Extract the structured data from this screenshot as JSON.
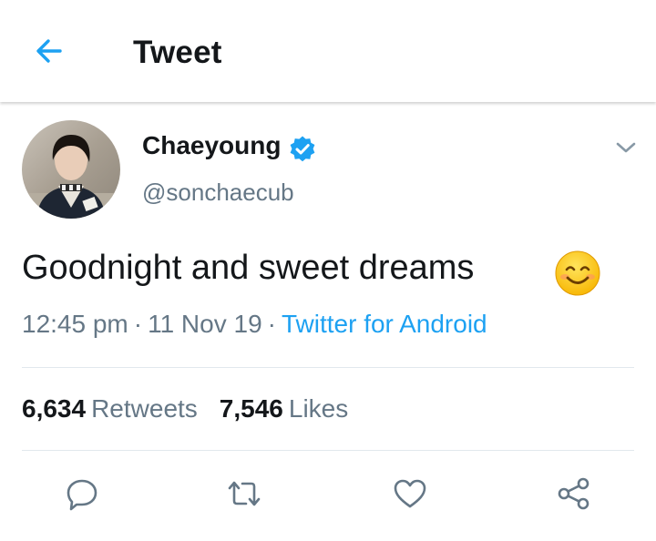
{
  "header": {
    "title": "Tweet",
    "back_icon": "arrow-left-icon"
  },
  "tweet": {
    "author": {
      "display_name": "Chaeyoung",
      "handle": "@sonchaecub",
      "verified": true,
      "verified_icon": "verified-badge-icon"
    },
    "text": "Goodnight and sweet dreams",
    "emoji": "smiling-face-icon",
    "meta": {
      "time": "12:45 pm",
      "separator": "·",
      "date": "11 Nov 19",
      "source": "Twitter for Android"
    },
    "stats": {
      "retweets_count": "6,634",
      "retweets_label": "Retweets",
      "likes_count": "7,546",
      "likes_label": "Likes"
    },
    "actions": {
      "reply_icon": "reply-icon",
      "retweet_icon": "retweet-icon",
      "like_icon": "heart-icon",
      "share_icon": "share-icon"
    }
  },
  "colors": {
    "accent": "#1da1f2",
    "text_primary": "#14171a",
    "text_secondary": "#657786",
    "divider": "#e1e8ed"
  }
}
